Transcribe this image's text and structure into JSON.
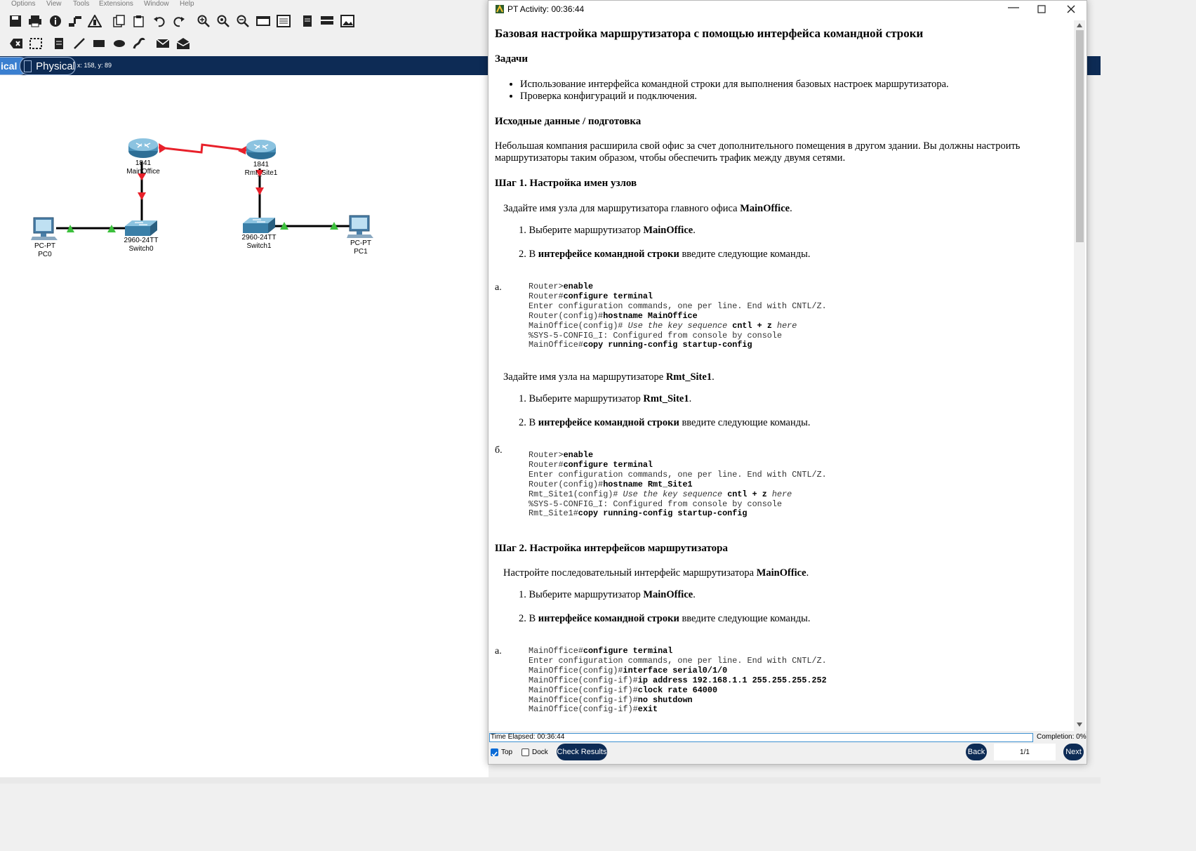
{
  "menubar": {
    "items": [
      "Options",
      "View",
      "Tools",
      "Extensions",
      "Window",
      "Help"
    ]
  },
  "modebar": {
    "logical_tab": "ical",
    "physical_tab": "Physical",
    "coords": "x: 158, y: 89"
  },
  "topology": {
    "routers": [
      {
        "model": "1841",
        "name": "MainOffice"
      },
      {
        "model": "1841",
        "name": "Rmt_Site1"
      }
    ],
    "switches": [
      {
        "model": "2960-24TT",
        "name": "Switch0"
      },
      {
        "model": "2960-24TT",
        "name": "Switch1"
      }
    ],
    "pcs": [
      {
        "model": "PC-PT",
        "name": "PC0"
      },
      {
        "model": "PC-PT",
        "name": "PC1"
      }
    ]
  },
  "activity": {
    "window_title": "PT Activity: 00:36:44",
    "title": "Базовая настройка маршрутизатора с помощью интерфейса командной строки",
    "tasks_heading": "Задачи",
    "tasks": [
      "Использование интерфейса командной строки для выполнения базовых настроек маршрутизатора.",
      "Проверка конфигураций и подключения."
    ],
    "background_heading": "Исходные данные / подготовка",
    "background_text": "Небольшая компания расширила свой офис за счет дополнительного помещения в другом здании. Вы должны настроить маршрутизаторы таким образом, чтобы обеспечить трафик между двумя сетями.",
    "step1_heading": "Шаг 1. Настройка имен узлов",
    "s1a_intro_pre": "Задайте имя узла для маршрутизатора главного офиса ",
    "s1a_intro_bold": "MainOffice",
    "s1a_item1_pre": "Выберите маршрутизатор ",
    "s1a_item1_bold": "MainOffice",
    "item2_pre": "В ",
    "item2_bold": "интерфейсе командной строки",
    "item2_post": " введите следующие команды.",
    "marker_a": "a.",
    "code_a": [
      [
        "Router>",
        "enable",
        ""
      ],
      [
        "Router#",
        "configure terminal",
        ""
      ],
      [
        "Enter configuration commands, one per line. End with CNTL/Z.",
        "",
        ""
      ],
      [
        "Router(config)#",
        "hostname MainOffice",
        ""
      ],
      [
        "MainOffice(config)# ",
        "",
        "Use the key sequence cntl + z here"
      ],
      [
        "%SYS-5-CONFIG_I: Configured from console by console",
        "",
        ""
      ],
      [
        "MainOffice#",
        "copy running-config startup-config",
        ""
      ]
    ],
    "s1b_intro_pre": "Задайте имя узла на маршрутизаторе ",
    "s1b_intro_bold": "Rmt_Site1",
    "s1b_item1_pre": "Выберите маршрутизатор ",
    "s1b_item1_bold": "Rmt_Site1",
    "marker_b": "б.",
    "code_b": [
      [
        "Router>",
        "enable",
        ""
      ],
      [
        "Router#",
        "configure terminal",
        ""
      ],
      [
        "Enter configuration commands, one per line. End with CNTL/Z.",
        "",
        ""
      ],
      [
        "Router(config)#",
        "hostname Rmt_Site1",
        ""
      ],
      [
        "Rmt_Site1(config)# ",
        "",
        "Use the key sequence cntl + z here"
      ],
      [
        "%SYS-5-CONFIG_I: Configured from console by console",
        "",
        ""
      ],
      [
        "Rmt_Site1#",
        "copy running-config startup-config",
        ""
      ]
    ],
    "step2_heading": "Шаг 2. Настройка интерфейсов маршрутизатора",
    "s2a_intro_pre": "Настройте последовательный интерфейс маршрутизатора ",
    "s2a_intro_bold": "MainOffice",
    "s2a_item1_pre": "Выберите маршрутизатор ",
    "s2a_item1_bold": "MainOffice",
    "marker_c": "a.",
    "code_c": [
      [
        "MainOffice#",
        "configure terminal",
        ""
      ],
      [
        "Enter configuration commands, one per line. End with CNTL/Z.",
        "",
        ""
      ],
      [
        "MainOffice(config)#",
        "interface serial0/1/0",
        ""
      ],
      [
        "MainOffice(config-if)#",
        "ip address 192.168.1.1 255.255.255.252",
        ""
      ],
      [
        "MainOffice(config-if)#",
        "clock rate 64000",
        ""
      ],
      [
        "MainOffice(config-if)#",
        "no shutdown",
        ""
      ],
      [
        "MainOffice(config-if)#",
        "exit",
        ""
      ]
    ],
    "time_elapsed": "Time Elapsed: 00:36:44",
    "completion": "Completion: 0%",
    "top_label": "Top",
    "dock_label": "Dock",
    "check_results": "Check Results",
    "back": "Back",
    "page": "1/1",
    "next": "Next"
  }
}
